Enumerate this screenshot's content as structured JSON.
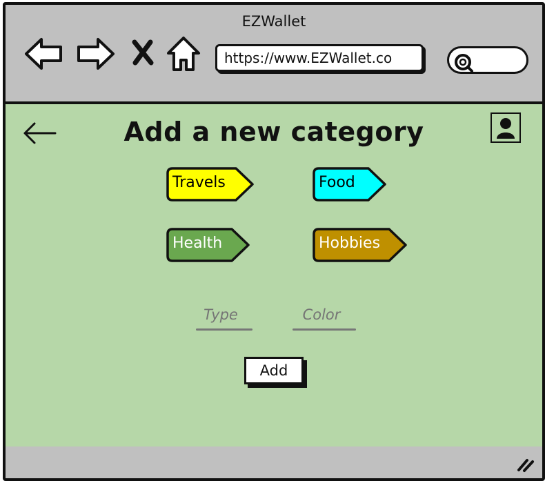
{
  "window": {
    "title": "EZWallet"
  },
  "browser": {
    "url": "https://www.EZWallet.co",
    "nav_icons": [
      "back-arrow-icon",
      "forward-arrow-icon",
      "close-icon",
      "home-icon",
      "search-icon"
    ]
  },
  "page": {
    "title": "Add a new category"
  },
  "categories": [
    {
      "label": "Travels",
      "color": "#ffff00",
      "text_color": "#000000"
    },
    {
      "label": "Food",
      "color": "#00ffff",
      "text_color": "#000000"
    },
    {
      "label": "Health",
      "color": "#6aa84f",
      "text_color": "#ffffff"
    },
    {
      "label": "Hobbies",
      "color": "#bf9000",
      "text_color": "#ffffff"
    }
  ],
  "form": {
    "type_placeholder": "Type",
    "color_placeholder": "Color",
    "add_label": "Add"
  },
  "colors": {
    "chrome": "#c0c0c0",
    "content_bg": "#b6d7a8",
    "border": "#111111"
  }
}
